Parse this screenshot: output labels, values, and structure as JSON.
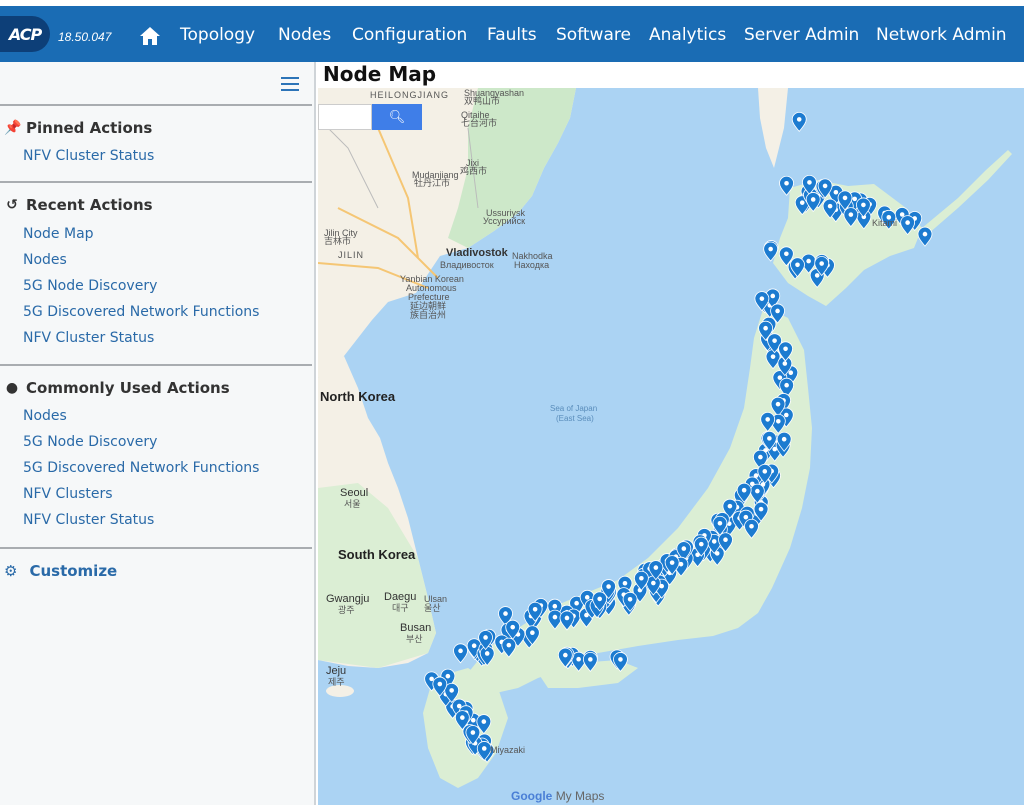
{
  "header": {
    "logo": "ACP",
    "version": "18.50.047",
    "nav": [
      "Topology",
      "Nodes",
      "Configuration",
      "Faults",
      "Software",
      "Analytics",
      "Server Admin",
      "Network Admin"
    ]
  },
  "sidebar": {
    "pinned": {
      "title": "Pinned Actions",
      "items": [
        "NFV Cluster Status"
      ]
    },
    "recent": {
      "title": "Recent Actions",
      "items": [
        "Node Map",
        "Nodes",
        "5G Node Discovery",
        "5G Discovered Network Functions",
        "NFV Cluster Status"
      ]
    },
    "common": {
      "title": "Commonly Used Actions",
      "items": [
        "Nodes",
        "5G Node Discovery",
        "5G Discovered Network Functions",
        "NFV Clusters",
        "NFV Cluster Status"
      ]
    },
    "customize": "Customize"
  },
  "main": {
    "title": "Node Map",
    "map": {
      "labels": {
        "heilongjiang": "HEILONGJIANG",
        "shuangyashan": "Shuangyashan",
        "shuangyashan_cn": "双鸭山市",
        "qitaihe": "Qitaihe",
        "qitaihe_cn": "七台河市",
        "jixi": "Jixi",
        "jixi_cn": "鸡西市",
        "mudanjiang": "Mudanjiang",
        "mudanjiang_cn": "牡丹江市",
        "ussuriysk": "Ussuriysk",
        "ussuriysk_ru": "Уссурийск",
        "jilin_city": "Jilin City",
        "jilin_city_cn": "吉林市",
        "jilin": "JILIN",
        "vladivostok": "Vladivostok",
        "vladivostok_ru": "Владивосток",
        "nakhodka": "Nakhodka",
        "nakhodka_ru": "Находка",
        "yanbian1": "Yanbian Korean",
        "yanbian2": "Autonomous",
        "yanbian3": "Prefecture",
        "yanbian_cn": "延边朝鲜",
        "yanbian_cn2": "族自治州",
        "kitami": "Kitami",
        "north_korea": "North Korea",
        "sea_of_japan": "Sea of Japan",
        "east_sea": "(East Sea)",
        "seoul": "Seoul",
        "seoul_kr": "서울",
        "south_korea": "South Korea",
        "gwangju": "Gwangju",
        "gwangju_kr": "광주",
        "daegu": "Daegu",
        "daegu_kr": "대구",
        "ulsan": "Ulsan",
        "ulsan_kr": "울산",
        "busan": "Busan",
        "busan_kr": "부산",
        "jeju": "Jeju",
        "jeju_kr": "제주",
        "miyazaki": "Miyazaki"
      },
      "footer_google": "Google",
      "footer_mymaps": "My Maps"
    }
  },
  "colors": {
    "nav_bg": "#1a6cb4",
    "link": "#2a6aa8",
    "water": "#abd3f3",
    "pin": "#1c7bd0"
  },
  "icons": {
    "home": "home-icon",
    "menu": "hamburger-icon",
    "pin": "pushpin-icon",
    "history": "history-icon",
    "circle": "circle-icon",
    "gear": "gear-icon",
    "search": "search-icon"
  }
}
